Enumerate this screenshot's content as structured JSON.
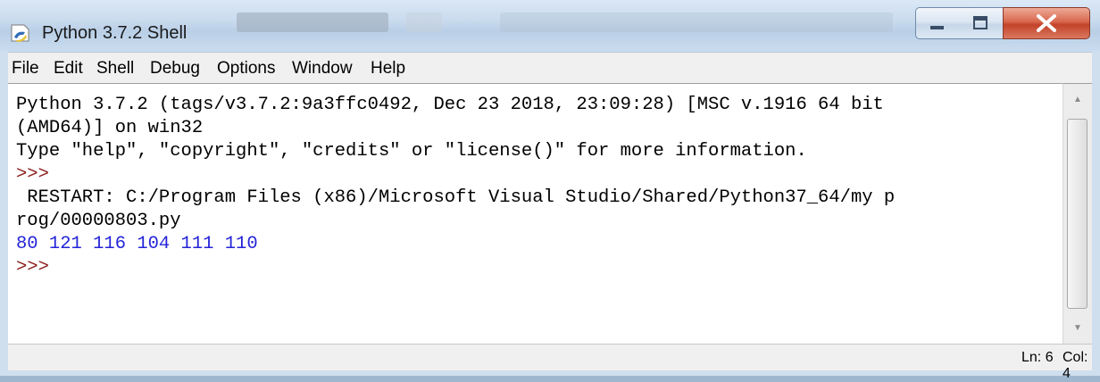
{
  "window": {
    "title": "Python 3.7.2 Shell"
  },
  "menu": [
    "File",
    "Edit",
    "Shell",
    "Debug",
    "Options",
    "Window",
    "Help"
  ],
  "shell": {
    "lines": [
      "Python 3.7.2 (tags/v3.7.2:9a3ffc0492, Dec 23 2018, 23:09:28) [MSC v.1916 64 bit",
      "(AMD64)] on win32",
      "Type \"help\", \"copyright\", \"credits\" or \"license()\" for more information.",
      ">>>",
      " RESTART: C:/Program Files (x86)/Microsoft Visual Studio/Shared/Python37_64/my p",
      "rog/00000803.py",
      "80 121 116 104 111 110",
      ">>>"
    ]
  },
  "status": {
    "line": "Ln: 6",
    "col": "Col: 4"
  },
  "colors": {
    "prompt": "#8b1a1a",
    "output": "#2424d8"
  },
  "icons": {
    "app": "python-idle-icon",
    "minimize": "minimize-icon",
    "maximize": "maximize-icon",
    "close": "close-icon"
  }
}
